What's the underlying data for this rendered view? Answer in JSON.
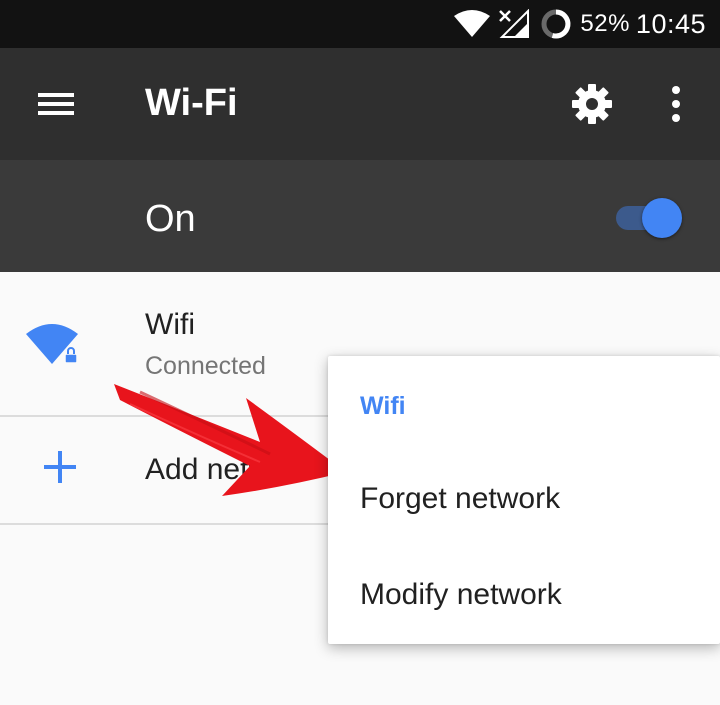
{
  "status_bar": {
    "battery_percent": "52%",
    "time": "10:45",
    "icons": [
      "wifi-signal-icon",
      "cellular-no-signal-icon",
      "battery-icon"
    ]
  },
  "toolbar": {
    "title": "Wi-Fi",
    "icons": [
      "menu-icon",
      "gear-icon",
      "more-vert-icon"
    ]
  },
  "master_switch": {
    "label": "On",
    "checked": true
  },
  "networks": [
    {
      "name": "Wifi",
      "status": "Connected",
      "icon": "wifi-locked-icon"
    }
  ],
  "add_network": {
    "label": "Add network",
    "icon": "plus-icon"
  },
  "context_menu": {
    "title": "Wifi",
    "items": [
      "Forget network",
      "Modify network"
    ]
  },
  "colors": {
    "accent": "#4285f4",
    "toolbar": "#2f2f2f",
    "switchbar": "#3a3a3a",
    "annotation_arrow": "#e8141c"
  }
}
